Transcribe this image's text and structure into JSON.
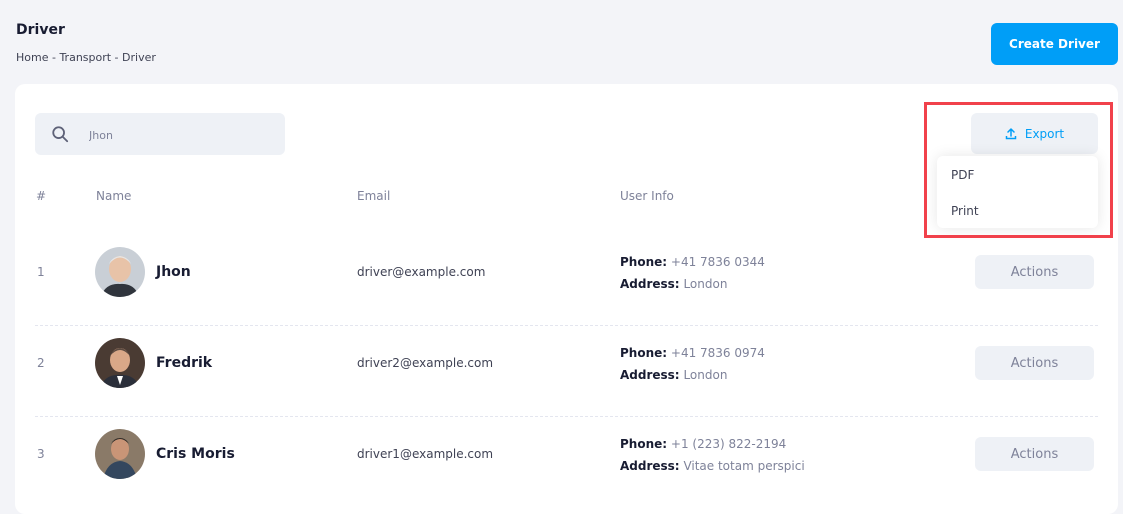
{
  "header": {
    "title": "Driver",
    "breadcrumb": "Home - Transport - Driver",
    "create_button": "Create Driver"
  },
  "search": {
    "value": "Jhon"
  },
  "export": {
    "label": "Export",
    "menu": [
      "PDF",
      "Print"
    ]
  },
  "table": {
    "columns": [
      "#",
      "Name",
      "Email",
      "User Info"
    ],
    "rows": [
      {
        "num": "1",
        "name": "Jhon",
        "email": "driver@example.com",
        "phone_label": "Phone:",
        "phone": "+41 7836 0344",
        "address_label": "Address:",
        "address": "London",
        "action": "Actions"
      },
      {
        "num": "2",
        "name": "Fredrik",
        "email": "driver2@example.com",
        "phone_label": "Phone:",
        "phone": "+41 7836 0974",
        "address_label": "Address:",
        "address": "London",
        "action": "Actions"
      },
      {
        "num": "3",
        "name": "Cris Moris",
        "email": "driver1@example.com",
        "phone_label": "Phone:",
        "phone": "+1 (223) 822-2194",
        "address_label": "Address:",
        "address": "Vitae totam perspici",
        "action": "Actions"
      }
    ]
  },
  "colors": {
    "primary": "#009ef7",
    "highlight": "#f1414b",
    "muted": "#eef1f6"
  }
}
